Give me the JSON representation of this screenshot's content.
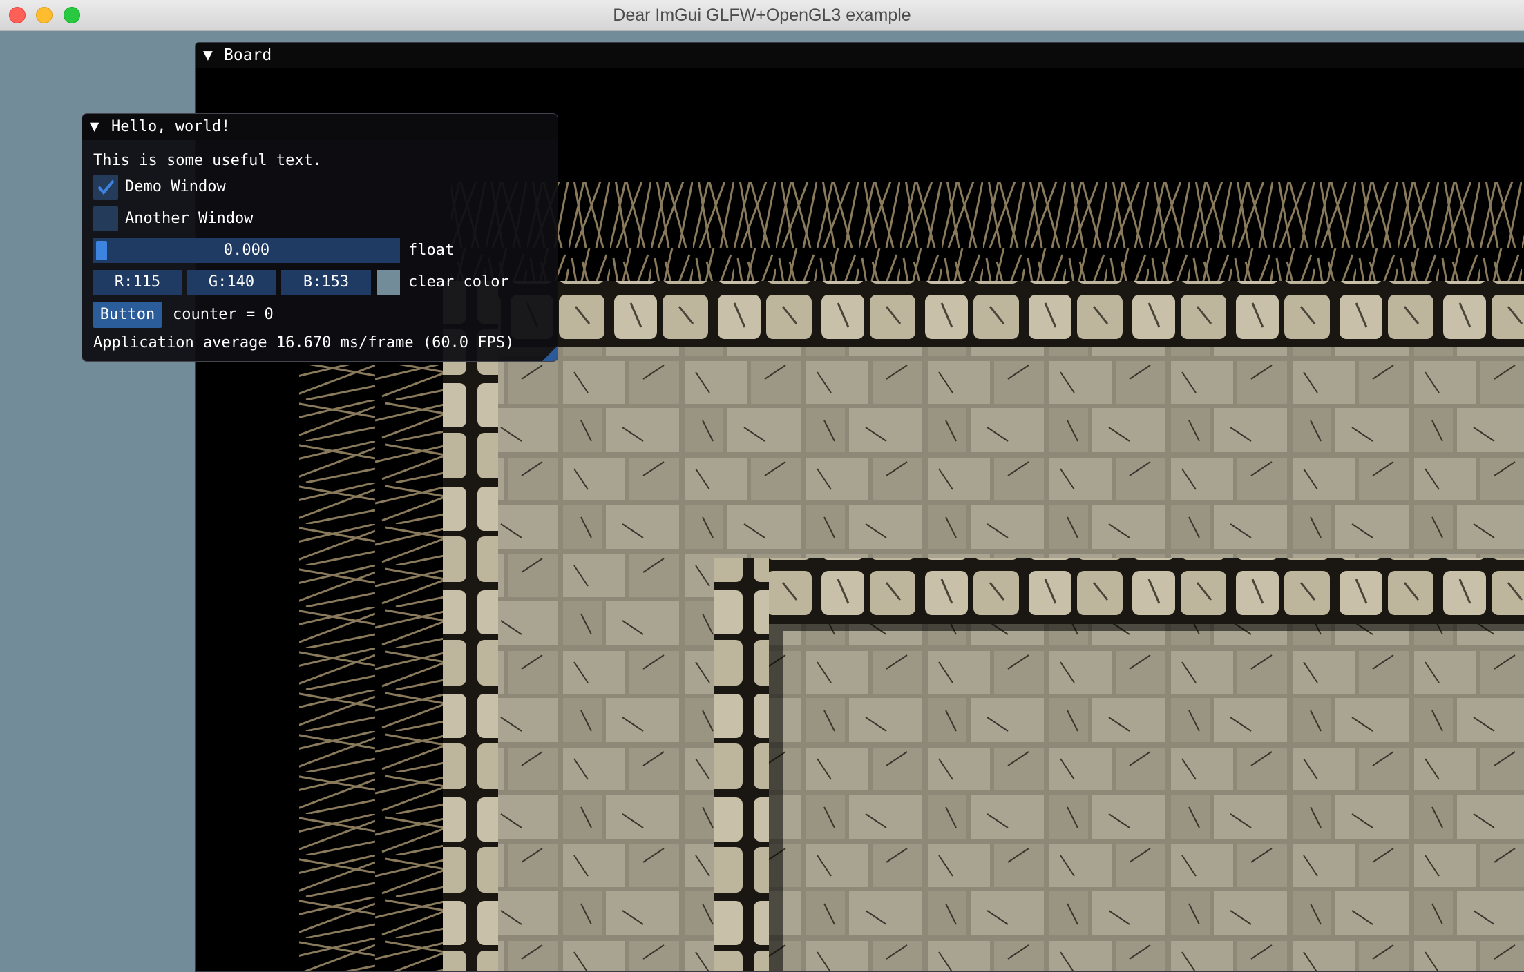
{
  "window": {
    "title": "Dear ImGui GLFW+OpenGL3 example",
    "controls": [
      "close",
      "minimize",
      "zoom"
    ]
  },
  "board": {
    "collapse_glyph": "▼",
    "title": "Board"
  },
  "hello": {
    "collapse_glyph": "▼",
    "title": "Hello, world!",
    "text": "This is some useful text.",
    "demo_checkbox": {
      "label": "Demo Window",
      "checked": true,
      "check_glyph": "✓"
    },
    "another_checkbox": {
      "label": "Another Window",
      "checked": false
    },
    "float_slider": {
      "value": "0.000",
      "label": "float"
    },
    "clear_color": {
      "r": "R:115",
      "g": "G:140",
      "b": "B:153",
      "label": "clear color",
      "swatch": "#738c99"
    },
    "button_label": "Button",
    "counter_text": "counter = 0",
    "fps_text": "Application average 16.670 ms/frame (60.0 FPS)"
  },
  "colors": {
    "background": "#738c99",
    "widget_frame": "#1f3a63",
    "accent": "#3d84e0",
    "button": "#2b5d9b"
  }
}
